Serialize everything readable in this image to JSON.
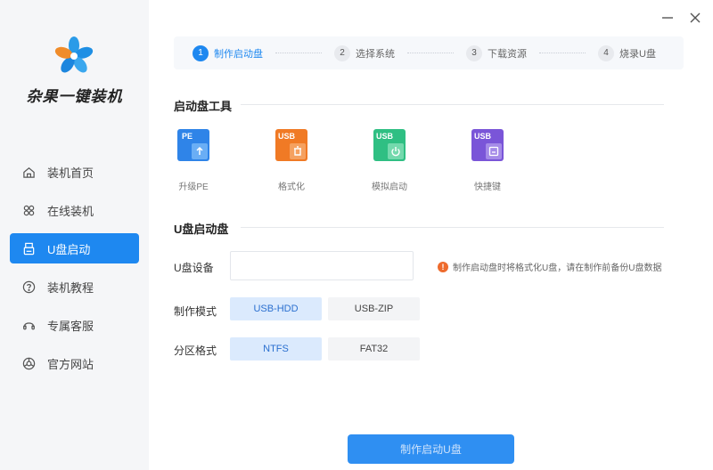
{
  "colors": {
    "accent": "#1e88f0",
    "sidebar_bg": "#f5f6f8",
    "warning": "#ee6b2d"
  },
  "sidebar": {
    "brand": "杂果一键装机",
    "items": [
      {
        "label": "装机首页",
        "icon": "home-icon",
        "active": false
      },
      {
        "label": "在线装机",
        "icon": "online-install-icon",
        "active": false
      },
      {
        "label": "U盘启动",
        "icon": "usb-drive-icon",
        "active": true
      },
      {
        "label": "装机教程",
        "icon": "help-icon",
        "active": false
      },
      {
        "label": "专属客服",
        "icon": "headset-icon",
        "active": false
      },
      {
        "label": "官方网站",
        "icon": "browser-icon",
        "active": false
      }
    ]
  },
  "window": {
    "minimize": "—",
    "close": "✕"
  },
  "stepper": [
    {
      "num": "1",
      "label": "制作启动盘",
      "active": true
    },
    {
      "num": "2",
      "label": "选择系统",
      "active": false
    },
    {
      "num": "3",
      "label": "下载资源",
      "active": false
    },
    {
      "num": "4",
      "label": "烧录U盘",
      "active": false
    }
  ],
  "tools": {
    "title": "启动盘工具",
    "items": [
      {
        "badge": "PE",
        "label": "升级PE",
        "icon": "upgrade-pe-icon",
        "color": "#2f84e8"
      },
      {
        "badge": "USB",
        "label": "格式化",
        "icon": "format-icon",
        "color": "#f07a25"
      },
      {
        "badge": "USB",
        "label": "模拟启动",
        "icon": "simulate-boot-icon",
        "color": "#2fbf83"
      },
      {
        "badge": "USB",
        "label": "快捷键",
        "icon": "shortcut-key-icon",
        "color": "#7a55d8"
      }
    ]
  },
  "usb": {
    "title": "U盘启动盘",
    "device_label": "U盘设备",
    "device_value": "",
    "warning": "制作启动盘时将格式化U盘，请在制作前备份U盘数据",
    "mode_label": "制作模式",
    "modes": [
      {
        "label": "USB-HDD",
        "selected": true
      },
      {
        "label": "USB-ZIP",
        "selected": false
      }
    ],
    "partition_label": "分区格式",
    "partitions": [
      {
        "label": "NTFS",
        "selected": true
      },
      {
        "label": "FAT32",
        "selected": false
      }
    ],
    "action": "制作启动U盘"
  }
}
